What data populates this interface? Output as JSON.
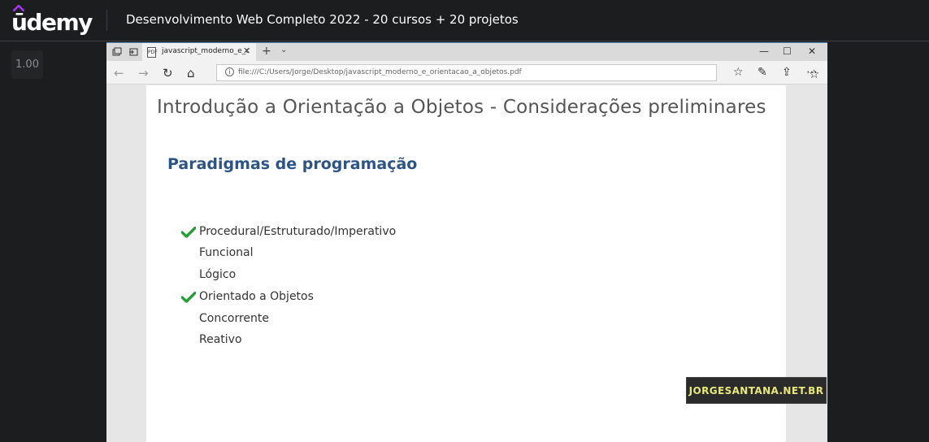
{
  "header": {
    "logo_text": "ūdemy",
    "course_title": "Desenvolvimento Web Completo 2022 - 20 cursos + 20 projetos"
  },
  "player": {
    "speed": "1.00"
  },
  "browser": {
    "tab_title": "javascript_moderno_e_c",
    "url": "file:///C:/Users/Jorge/Desktop/javascript_moderno_e_orientacao_a_objetos.pdf"
  },
  "slide": {
    "title": "Introdução a Orientação a Objetos - Considerações preliminares",
    "section_title": "Paradigmas de programação",
    "items": [
      {
        "label": "Procedural/Estruturado/Imperativo",
        "checked": true
      },
      {
        "label": "Funcional",
        "checked": false
      },
      {
        "label": "Lógico",
        "checked": false
      },
      {
        "label": "Orientado a Objetos",
        "checked": true
      },
      {
        "label": "Concorrente",
        "checked": false
      },
      {
        "label": "Reativo",
        "checked": false
      }
    ]
  },
  "watermark": "JORGESANTANA.NET.BR",
  "colors": {
    "brand_purple": "#a435f0",
    "check_green": "#22a035",
    "section_blue": "#2d5486"
  }
}
